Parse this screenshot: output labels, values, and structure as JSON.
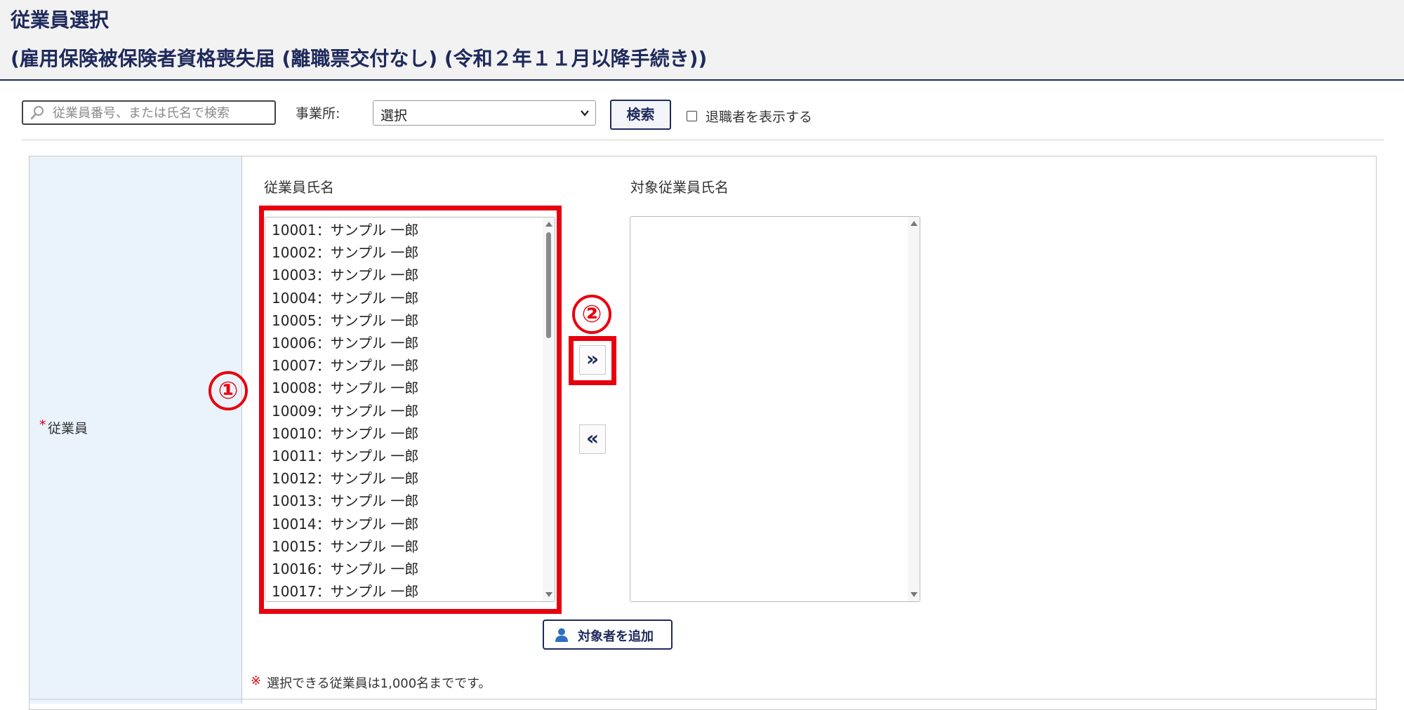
{
  "header": {
    "title": "従業員選択",
    "subtitle": "(雇用保険被保険者資格喪失届 (離職票交付なし) (令和２年１１月以降手続き))"
  },
  "toolbar": {
    "search_placeholder": "従業員番号、または氏名で検索",
    "search_value": "",
    "office_label": "事業所:",
    "office_selected": "選択",
    "search_button": "検索",
    "retired_label": "退職者を表示する",
    "retired_checked": false
  },
  "form": {
    "required_mark": "*",
    "field_label": "従業員",
    "source_header": "従業員氏名",
    "target_header": "対象従業員氏名",
    "source_items": [
      "10001：サンプル 一郎",
      "10002：サンプル 一郎",
      "10003：サンプル 一郎",
      "10004：サンプル 一郎",
      "10005：サンプル 一郎",
      "10006：サンプル 一郎",
      "10007：サンプル 一郎",
      "10008：サンプル 一郎",
      "10009：サンプル 一郎",
      "10010：サンプル 一郎",
      "10011：サンプル 一郎",
      "10012：サンプル 一郎",
      "10013：サンプル 一郎",
      "10014：サンプル 一郎",
      "10015：サンプル 一郎",
      "10016：サンプル 一郎",
      "10017：サンプル 一郎"
    ],
    "target_items": [],
    "move_right": "»",
    "move_left": "«",
    "add_target_button": "対象者を追加",
    "note_mark": "※",
    "note_text": "選択できる従業員は1,000名までです。"
  },
  "annotations": {
    "callout_1": "①",
    "callout_2": "②",
    "highlight_color": "#e8000e"
  },
  "icons": {
    "search": "search-icon",
    "chevron": "chevron-down-icon",
    "person": "person-icon"
  }
}
